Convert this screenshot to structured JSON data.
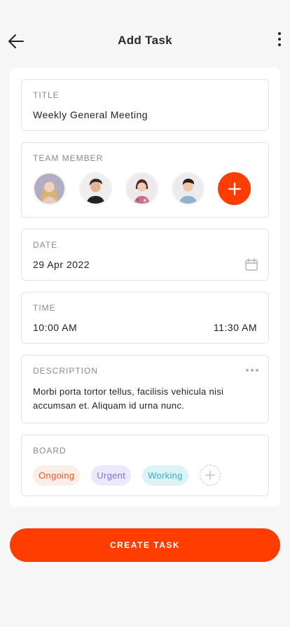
{
  "header": {
    "title": "Add Task",
    "back_icon": "arrow-left-icon",
    "more_icon": "more-vertical-icon"
  },
  "task_title": {
    "label": "TITLE",
    "value": "Weekly General Meeting"
  },
  "team": {
    "label": "TEAM MEMBER",
    "members": [
      "avatar-woman-blonde",
      "avatar-man-dark-hair",
      "avatar-woman-floral",
      "avatar-man-smiling"
    ],
    "add_icon": "plus-icon"
  },
  "date": {
    "label": "DATE",
    "value": "29 Apr 2022",
    "icon": "calendar-icon"
  },
  "time": {
    "label": "TIME",
    "start": "10:00 AM",
    "end": "11:30 AM"
  },
  "description": {
    "label": "DESCRIPTION",
    "text": "Morbi porta tortor tellus, facilisis vehicula nisi accumsan et. Aliquam id urna nunc.",
    "menu_icon": "more-horizontal-icon"
  },
  "board": {
    "label": "BOARD",
    "tags": [
      "Ongoing",
      "Urgent",
      "Working"
    ],
    "add_icon": "plus-icon"
  },
  "create_button": {
    "label": "CREATE TASK"
  },
  "colors": {
    "accent": "#ff3d00",
    "ongoing": "#f05a2a",
    "urgent": "#7b74d6",
    "working": "#35aec3"
  }
}
